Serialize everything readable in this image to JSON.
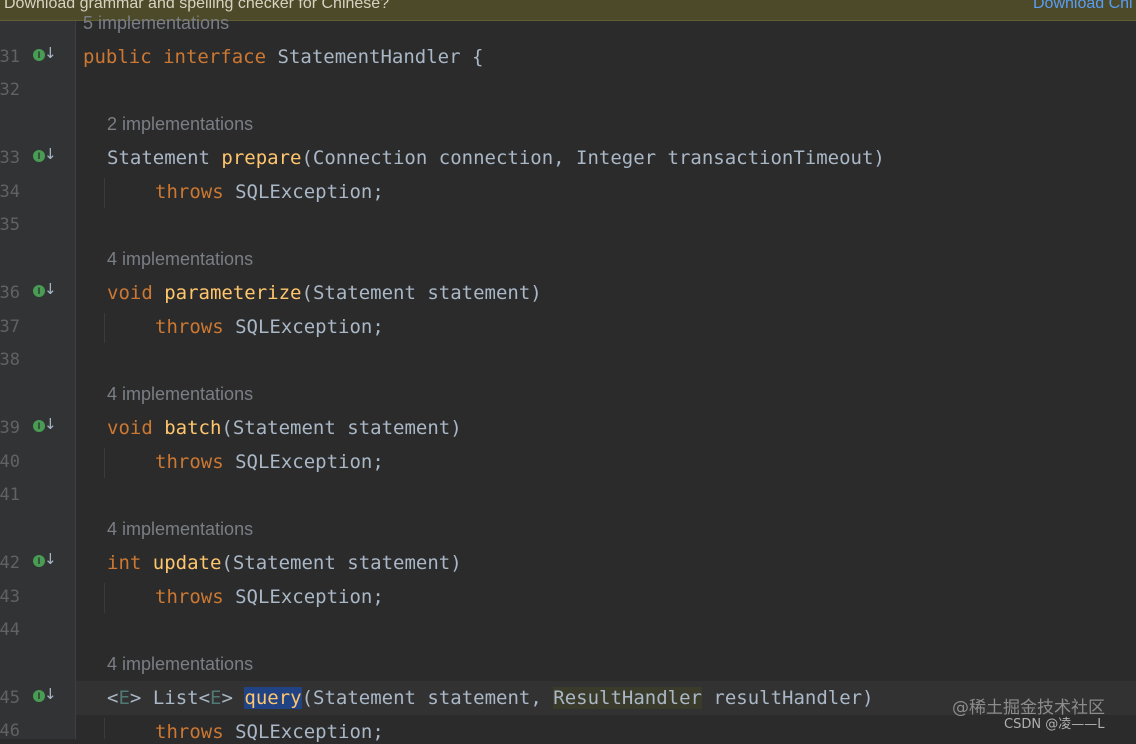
{
  "banner": {
    "message": "Download grammar and spelling checker for Chinese?",
    "action": "Download Chi"
  },
  "line_numbers": [
    "31",
    "32",
    "33",
    "34",
    "35",
    "36",
    "37",
    "38",
    "39",
    "40",
    "41",
    "42",
    "43",
    "44",
    "45",
    "46"
  ],
  "hints": {
    "top": "5 implementations",
    "prepare": "2 implementations",
    "parameterize": "4 implementations",
    "batch": "4 implementations",
    "update": "4 implementations",
    "query": "4 implementations"
  },
  "code": {
    "l31": {
      "kw1": "public",
      "kw2": "interface",
      "name": "StatementHandler",
      "brace": "{"
    },
    "l33": {
      "ret": "Statement",
      "fn": "prepare",
      "params": "(Connection connection, Integer transactionTimeout)"
    },
    "l36": {
      "ret": "void",
      "fn": "parameterize",
      "params": "(Statement statement)"
    },
    "l39": {
      "ret": "void",
      "fn": "batch",
      "params": "(Statement statement)"
    },
    "l42": {
      "ret": "int",
      "fn": "update",
      "params": "(Statement statement)"
    },
    "l45": {
      "lt1": "<",
      "tp1": "E",
      "gt1": ">",
      "list": "List<",
      "tp2": "E",
      "gt2": ">",
      "fn": "query",
      "p1": "(Statement statement, ",
      "p2": "ResultHandler",
      "p3": " resultHandler)"
    },
    "throws_kw": "throws",
    "throws_ex": "SQLException;"
  },
  "icons": {
    "implemented": "implemented-down-arrow-icon"
  },
  "watermark": "@稀土掘金技术社区",
  "credit": "CSDN @凌——L",
  "colors": {
    "background": "#2b2b2b",
    "keyword": "#cc7832",
    "function": "#ffc66d",
    "text": "#a9b7c6",
    "selection": "#214283"
  }
}
